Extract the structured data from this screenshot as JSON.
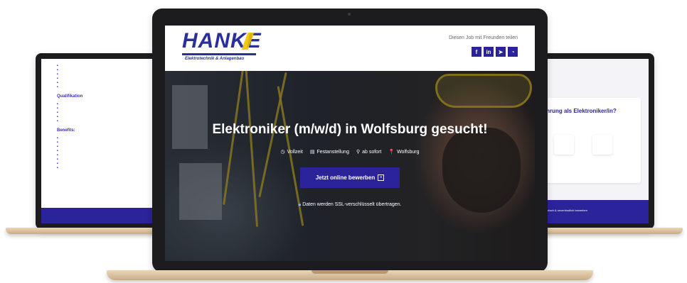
{
  "center": {
    "logo": {
      "main": "HANKE",
      "sub": "Elektrotechnik & Anlagenbau"
    },
    "share": {
      "label": "Diesen Job mit Freunden teilen",
      "buttons": [
        {
          "icon": "facebook-icon",
          "glyph": "f"
        },
        {
          "icon": "linkedin-icon",
          "glyph": "in"
        },
        {
          "icon": "telegram-icon",
          "glyph": "➤"
        },
        {
          "icon": "whatsapp-icon",
          "glyph": "◔"
        }
      ]
    },
    "hero": {
      "title": "Elektroniker (m/w/d) in Wolfsburg gesucht!",
      "facts": [
        {
          "icon": "clock-icon",
          "glyph": "◷",
          "label": "Vollzeit"
        },
        {
          "icon": "document-icon",
          "glyph": "▤",
          "label": "Festanstellung"
        },
        {
          "icon": "person-icon",
          "glyph": "⚲",
          "label": "ab sofort"
        },
        {
          "icon": "location-pin-icon",
          "glyph": "📍",
          "label": "Wolfsburg"
        }
      ],
      "apply_label": "Jetzt online bewerben",
      "ssl_text": "Daten werden SSL-verschlüsselt übertragen."
    }
  },
  "left": {
    "bullets_top": [
      "",
      "",
      "",
      "",
      "",
      ""
    ],
    "heading_qualifikation": "Qualifikation",
    "bullets_quali": [
      "",
      "",
      "",
      "",
      ""
    ],
    "heading_benefits": "Benefits:",
    "bullets_benefits": [
      "",
      "",
      "",
      "",
      "",
      "",
      "",
      ""
    ]
  },
  "right": {
    "question": "fahrung als Elektroniker/in?",
    "bottom_text": "in 60s. einfach & unverbindlich bewerben"
  },
  "colors": {
    "brand": "#2b2399",
    "logo": "#2a2f9c",
    "accent_yellow": "#f2c200"
  }
}
